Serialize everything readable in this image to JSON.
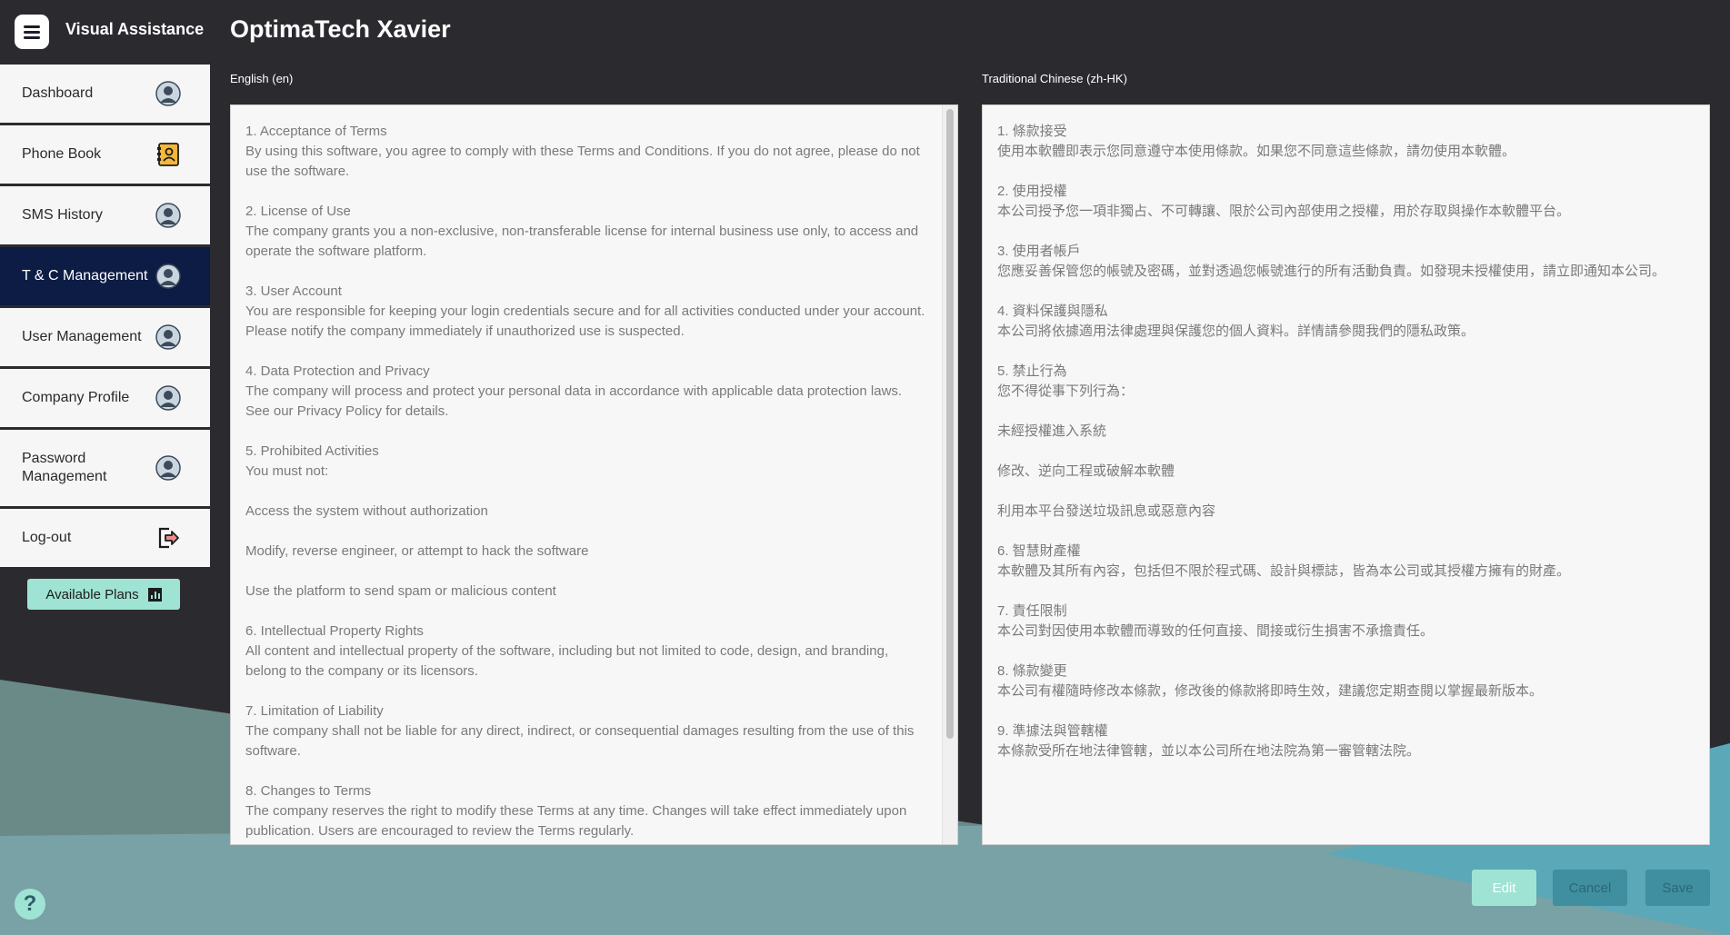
{
  "app": {
    "brand": "Visual Assistance",
    "page_title": "OptimaTech Xavier"
  },
  "sidebar": {
    "items": [
      {
        "label": "Dashboard",
        "icon": "user-avatar-icon",
        "active": false
      },
      {
        "label": "Phone Book",
        "icon": "contact-book-icon",
        "active": false
      },
      {
        "label": "SMS History",
        "icon": "user-avatar-icon",
        "active": false
      },
      {
        "label": "T & C Management",
        "icon": "user-avatar-icon",
        "active": true
      },
      {
        "label": "User Management",
        "icon": "user-avatar-icon",
        "active": false
      },
      {
        "label": "Company Profile",
        "icon": "user-avatar-icon",
        "active": false
      },
      {
        "label": "Password Management",
        "icon": "user-avatar-icon",
        "active": false
      },
      {
        "label": "Log-out",
        "icon": "logout-icon",
        "active": false
      }
    ],
    "plans_button": "Available Plans",
    "plans_icon": "chart-icon"
  },
  "panels": {
    "english": {
      "label": "English (en)",
      "paragraphs": [
        "1. Acceptance of Terms\nBy using this software, you agree to comply with these Terms and Conditions. If you do not agree, please do not use the software.",
        "2. License of Use\nThe company grants you a non-exclusive, non-transferable license for internal business use only, to access and operate the software platform.",
        "3. User Account\nYou are responsible for keeping your login credentials secure and for all activities conducted under your account. Please notify the company immediately if unauthorized use is suspected.",
        "4. Data Protection and Privacy\nThe company will process and protect your personal data in accordance with applicable data protection laws. See our Privacy Policy for details.",
        "5. Prohibited Activities\nYou must not:",
        "Access the system without authorization",
        "Modify, reverse engineer, or attempt to hack the software",
        "Use the platform to send spam or malicious content",
        "6. Intellectual Property Rights\nAll content and intellectual property of the software, including but not limited to code, design, and branding, belong to the company or its licensors.",
        "7. Limitation of Liability\nThe company shall not be liable for any direct, indirect, or consequential damages resulting from the use of this software.",
        "8. Changes to Terms\nThe company reserves the right to modify these Terms at any time. Changes will take effect immediately upon publication. Users are encouraged to review the Terms regularly."
      ]
    },
    "chinese": {
      "label": "Traditional Chinese (zh-HK)",
      "paragraphs": [
        "1. 條款接受\n使用本軟體即表示您同意遵守本使用條款。如果您不同意這些條款，請勿使用本軟體。",
        "2. 使用授權\n本公司授予您一項非獨占、不可轉讓、限於公司內部使用之授權，用於存取與操作本軟體平台。",
        "3. 使用者帳戶\n您應妥善保管您的帳號及密碼，並對透過您帳號進行的所有活動負責。如發現未授權使用，請立即通知本公司。",
        "4. 資料保護與隱私\n本公司將依據適用法律處理與保護您的個人資料。詳情請參閱我們的隱私政策。",
        "5. 禁止行為\n您不得從事下列行為：",
        "未經授權進入系統",
        "修改、逆向工程或破解本軟體",
        "利用本平台發送垃圾訊息或惡意內容",
        "6. 智慧財產權\n本軟體及其所有內容，包括但不限於程式碼、設計與標誌，皆為本公司或其授權方擁有的財產。",
        "7. 責任限制\n本公司對因使用本軟體而導致的任何直接、間接或衍生損害不承擔責任。",
        "8. 條款變更\n本公司有權隨時修改本條款，修改後的條款將即時生效，建議您定期查閱以掌握最新版本。",
        "9. 準據法與管轄權\n本條款受所在地法律管轄，並以本公司所在地法院為第一審管轄法院。"
      ]
    }
  },
  "actions": {
    "edit": "Edit",
    "cancel": "Cancel",
    "save": "Save"
  },
  "help_glyph": "?",
  "colors": {
    "background": "#2b2b2f",
    "sidebar_active": "#0c1c44",
    "accent": "#9fe3d4",
    "teal": "#3f8fa0"
  }
}
